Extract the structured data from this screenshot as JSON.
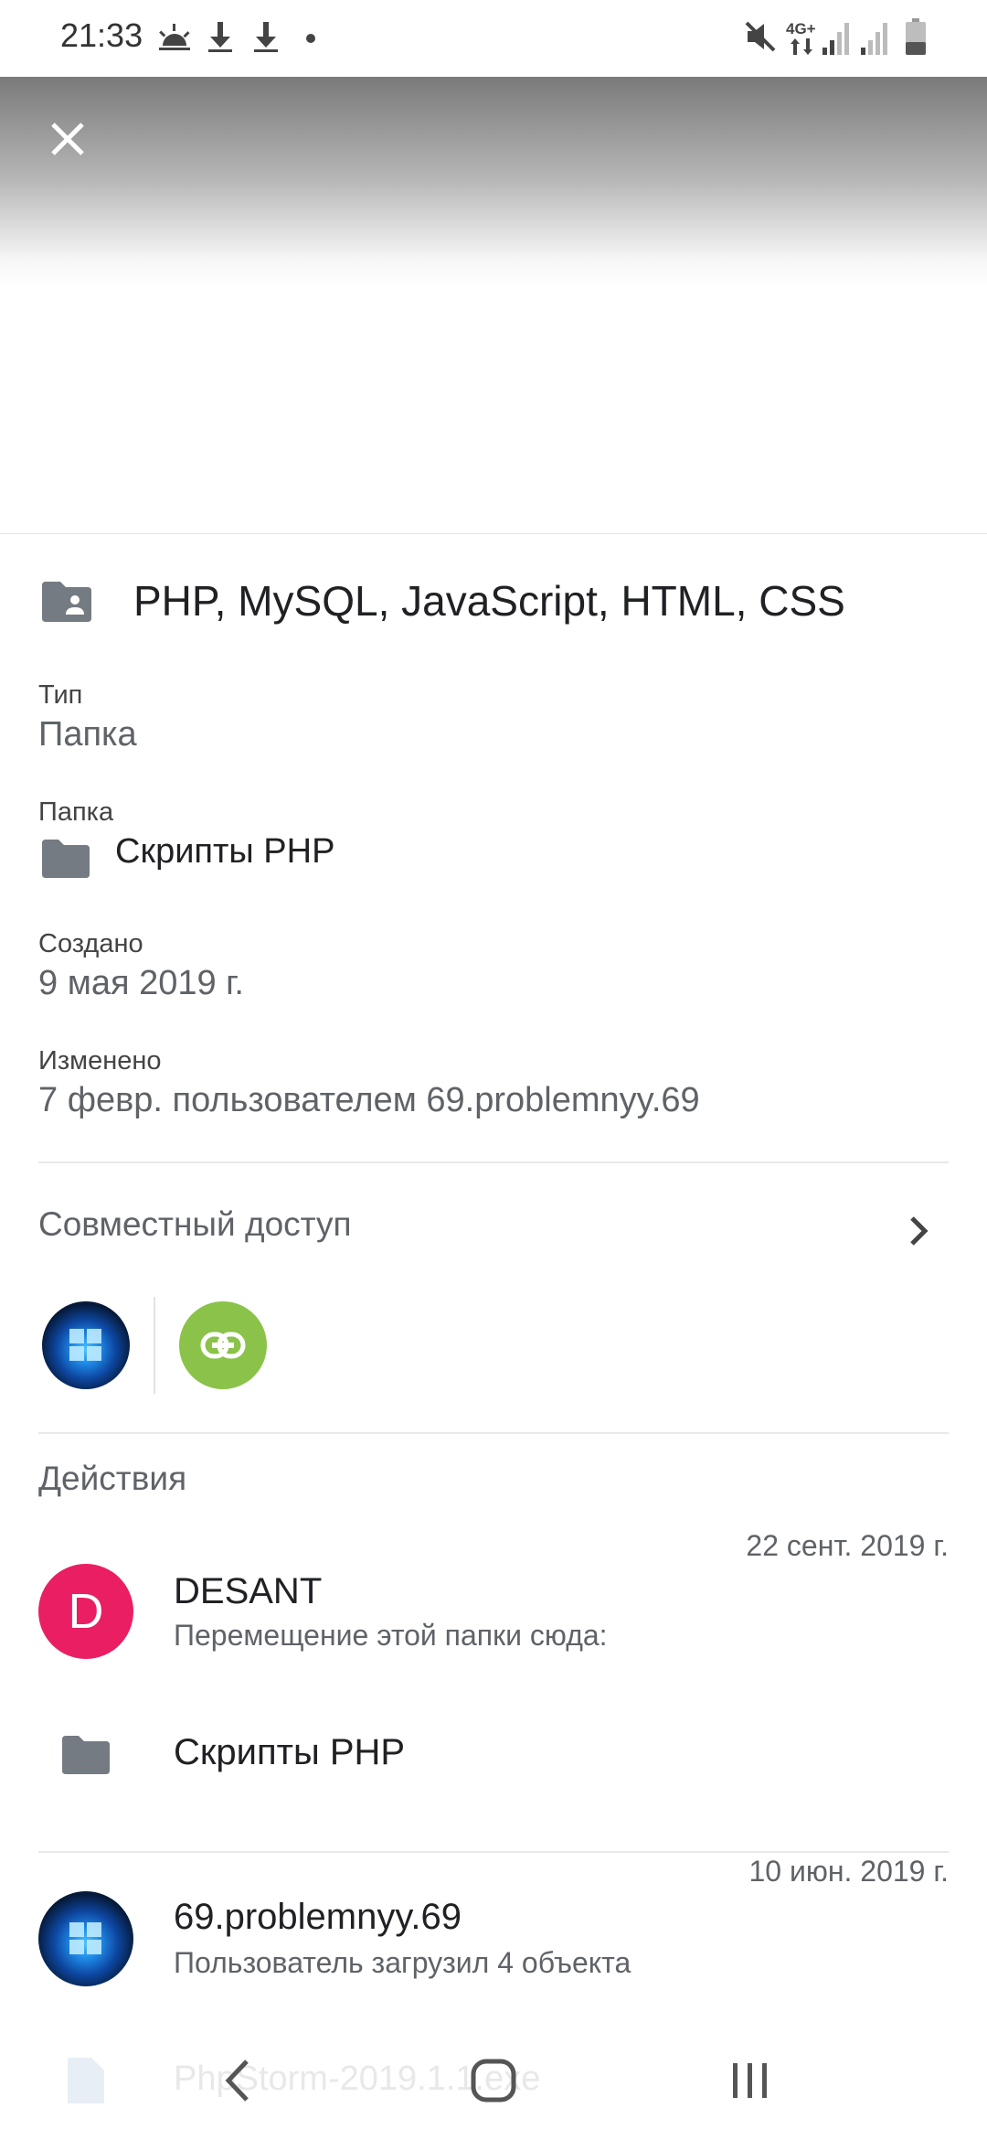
{
  "status_bar": {
    "time": "21:33",
    "network": "4G+",
    "icons": [
      "weather-icon",
      "download-icon",
      "download-icon",
      "dot-icon",
      "mute-icon",
      "signal-icon",
      "battery-icon"
    ]
  },
  "file": {
    "title": "PHP, MySQL, JavaScript, HTML, CSS",
    "type_label": "Тип",
    "type_value": "Папка",
    "folder_label": "Папка",
    "folder_value": "Скрипты PHP",
    "created_label": "Создано",
    "created_value": "9 мая 2019 г.",
    "modified_label": "Изменено",
    "modified_value": "7 февр. пользователем 69.problemnyy.69"
  },
  "sharing": {
    "title": "Совместный доступ"
  },
  "activity": {
    "title": "Действия",
    "items": [
      {
        "date": "22 сент. 2019 г.",
        "avatar_letter": "D",
        "name": "DESANT",
        "description": "Перемещение этой папки сюда:",
        "target": "Скрипты PHP"
      },
      {
        "date": "10 июн. 2019 г.",
        "name": "69.problemnyy.69",
        "description": "Пользователь загрузил 4 объекта",
        "file": "PhpStorm-2019.1.1.exe"
      }
    ]
  },
  "colors": {
    "accent_pink": "#e91e63",
    "link_green": "#8bc34a",
    "icon_gray": "#757b82"
  }
}
